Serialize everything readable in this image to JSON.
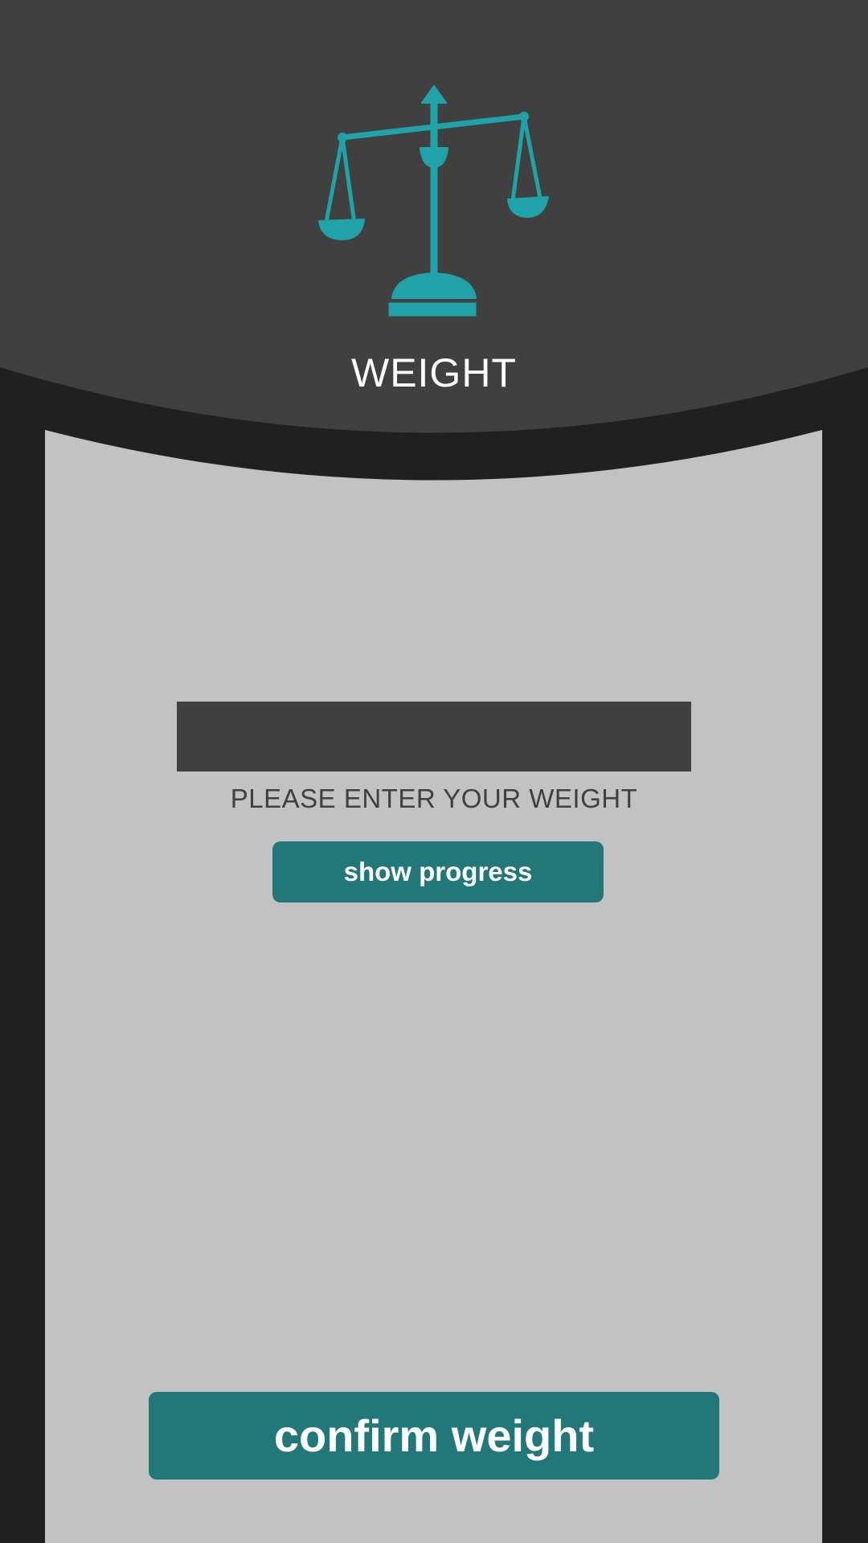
{
  "header": {
    "title": "WEIGHT",
    "logo_icon": "scale-icon"
  },
  "form": {
    "weight_input": {
      "value": "",
      "placeholder": ""
    },
    "input_label": "PLEASE ENTER YOUR WEIGHT",
    "show_progress_label": "show progress",
    "confirm_label": "confirm weight"
  },
  "colors": {
    "header_bg": "#404040",
    "frame": "#202020",
    "content_bg": "#c2c2c2",
    "accent": "#1fa3a8",
    "button": "#227779"
  }
}
